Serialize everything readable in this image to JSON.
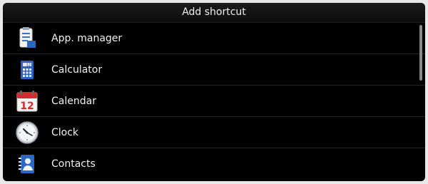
{
  "dialog": {
    "title": "Add shortcut"
  },
  "items": [
    {
      "label": "App. manager",
      "icon": "app-manager-icon"
    },
    {
      "label": "Calculator",
      "icon": "calculator-icon"
    },
    {
      "label": "Calendar",
      "icon": "calendar-icon",
      "icon_text": "12"
    },
    {
      "label": "Clock",
      "icon": "clock-icon"
    },
    {
      "label": "Contacts",
      "icon": "contacts-icon"
    }
  ],
  "colors": {
    "background": "#000000",
    "divider": "#1e2329",
    "text": "#f2f2f2"
  }
}
